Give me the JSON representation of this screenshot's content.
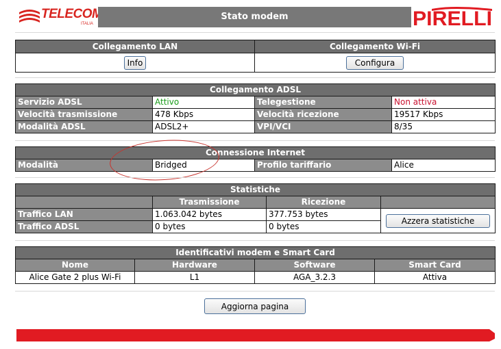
{
  "header": {
    "logo_left_text": "TELECOM",
    "logo_left_sub": "ITALIA",
    "title": "Stato modem",
    "logo_right_text": "PIRELLI",
    "brand_red": "#e11b22"
  },
  "collegamento": {
    "lan_title": "Collegamento LAN",
    "wifi_title": "Collegamento Wi-Fi",
    "info_label": "Info",
    "configura_label": "Configura"
  },
  "adsl": {
    "title": "Collegamento ADSL",
    "rows": [
      {
        "l1": "Servizio ADSL",
        "v1": "Attivo",
        "l2": "Telegestione",
        "v2": "Non attiva"
      },
      {
        "l1": "Velocità trasmissione",
        "v1": "478 Kbps",
        "l2": "Velocità ricezione",
        "v2": "19517 Kbps"
      },
      {
        "l1": "Modalità ADSL",
        "v1": "ADSL2+",
        "l2": "VPI/VCI",
        "v2": "8/35"
      }
    ]
  },
  "internet": {
    "title": "Connessione Internet",
    "l1": "Modalità",
    "v1": "Bridged",
    "l2": "Profilo tariffario",
    "v2": "Alice"
  },
  "stats": {
    "title": "Statistiche",
    "col_tx": "Trasmissione",
    "col_rx": "Ricezione",
    "rows": [
      {
        "label": "Traffico LAN",
        "tx": "1.063.042 bytes",
        "rx": "377.753 bytes"
      },
      {
        "label": "Traffico ADSL",
        "tx": "0 bytes",
        "rx": "0 bytes"
      }
    ],
    "reset_label": "Azzera statistiche"
  },
  "ident": {
    "title": "Identificativi modem e Smart Card",
    "headers": [
      "Nome",
      "Hardware",
      "Software",
      "Smart Card"
    ],
    "values": [
      "Alice Gate 2 plus Wi-Fi",
      "L1",
      "AGA_3.2.3",
      "Attiva"
    ]
  },
  "refresh_label": "Aggiorna pagina"
}
